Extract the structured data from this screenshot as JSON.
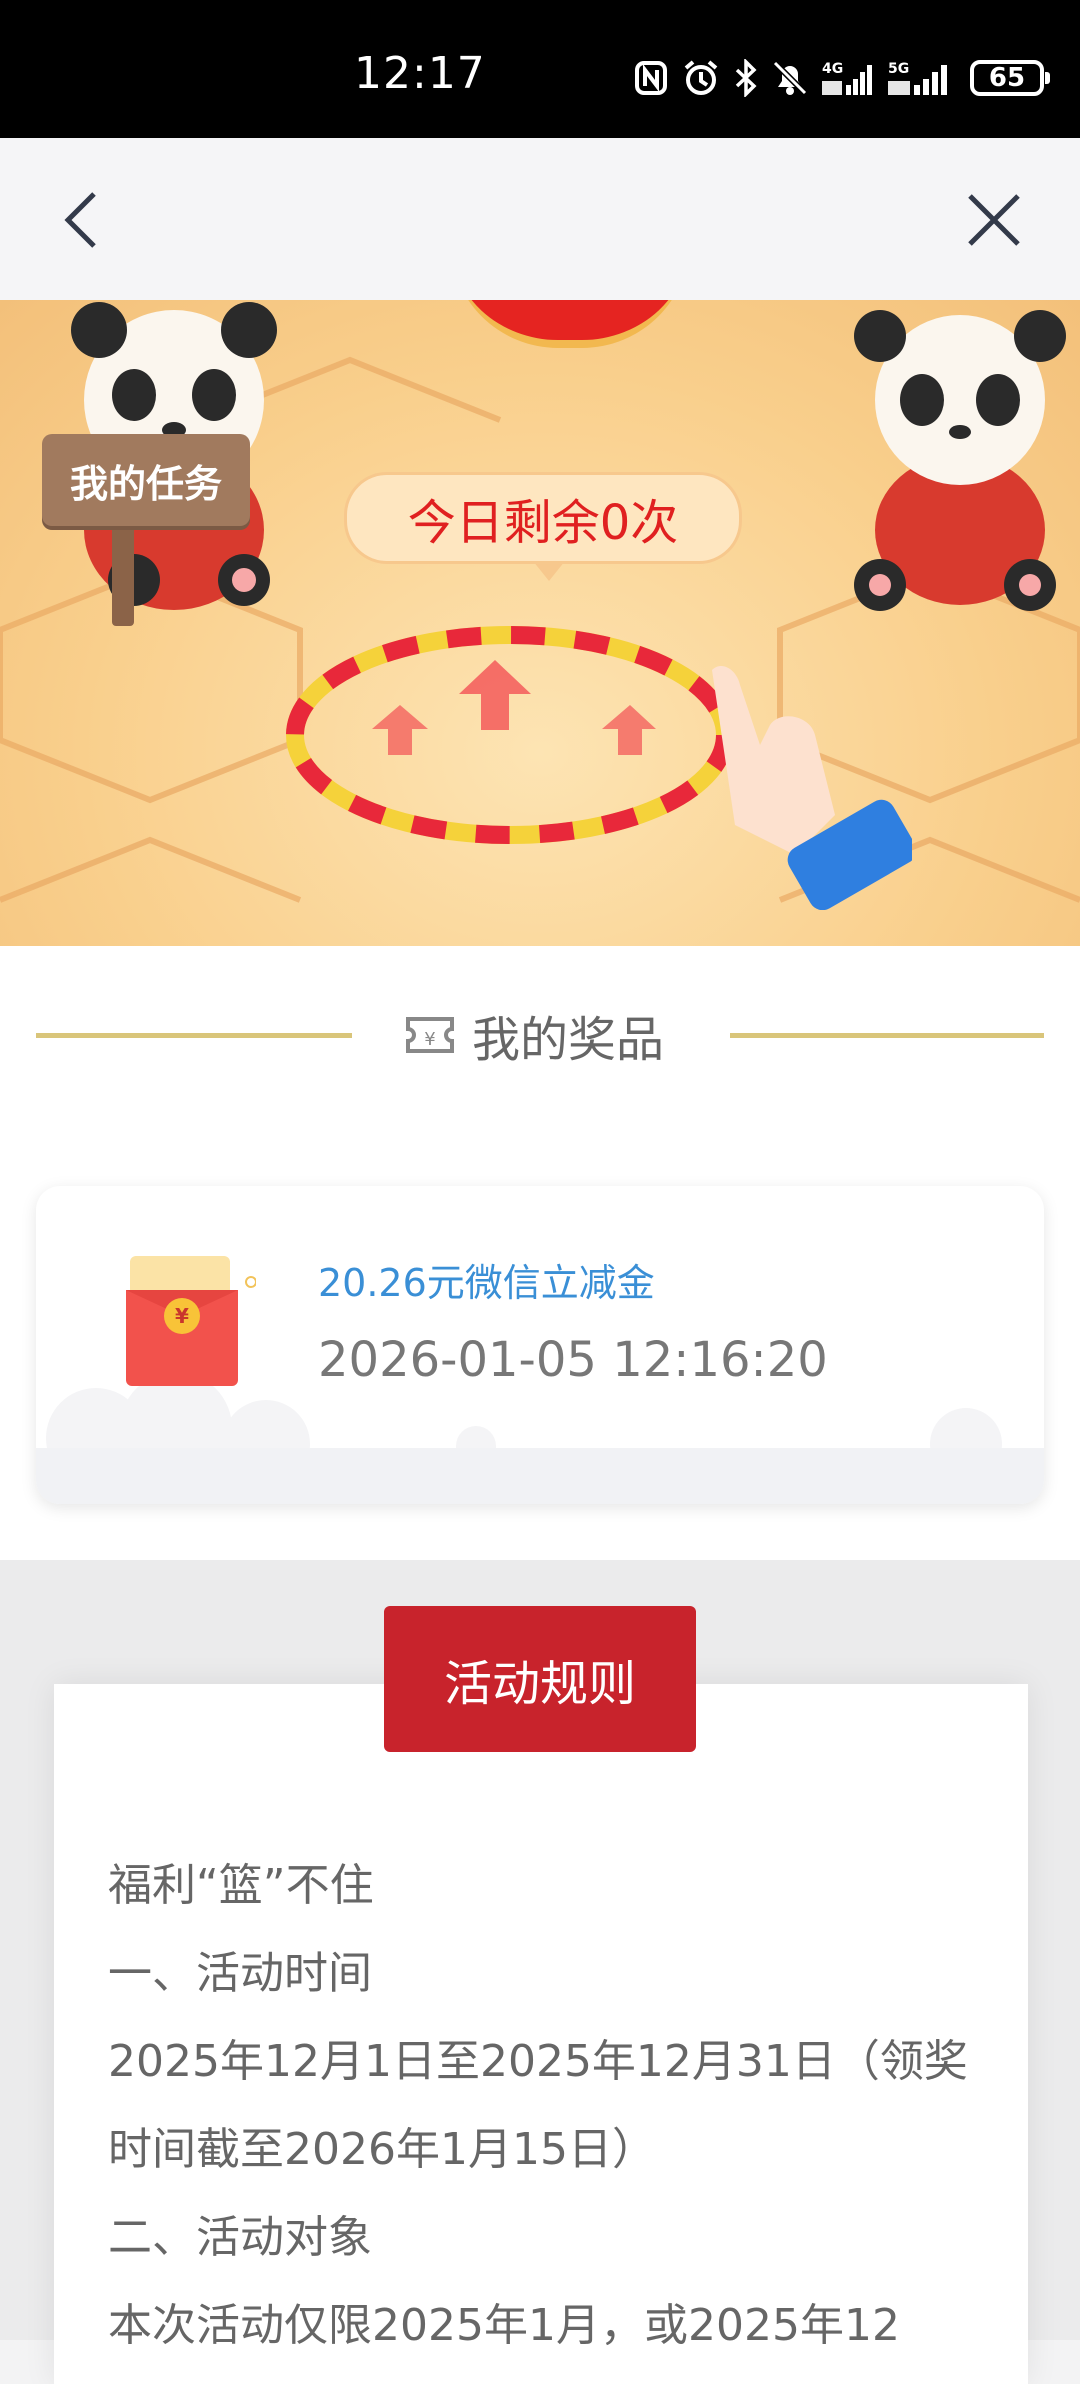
{
  "status_bar": {
    "time": "12:17",
    "battery": "65"
  },
  "nav": {
    "back_icon": "chevron-left-icon",
    "close_icon": "close-icon"
  },
  "banner": {
    "my_task": "我的任务",
    "remaining_today": "今日剩余0次"
  },
  "prizes": {
    "title": "我的奖品",
    "items": [
      {
        "name": "20.26元微信立减金",
        "time": "2026-01-05 12:16:20"
      }
    ]
  },
  "rules": {
    "tab_label": "活动规则",
    "lines": [
      "福利“篮”不住",
      "一、活动时间",
      "2025年12月1日至2025年12月31日（领奖时间截至2026年1月15日）",
      "二、活动对象",
      "本次活动仅限2025年1月，或2025年12"
    ]
  },
  "colors": {
    "accent_red": "#c8232c",
    "prize_blue": "#3a8fd6",
    "gold_line": "#d9c57a"
  }
}
